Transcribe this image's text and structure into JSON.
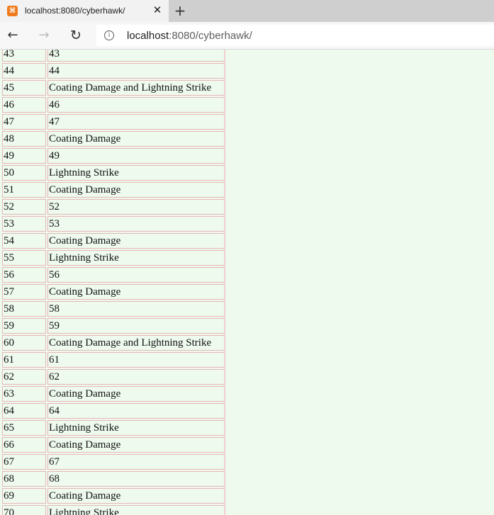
{
  "browser": {
    "tab_title": "localhost:8080/cyberhawk/",
    "url_host": "localhost",
    "url_rest": ":8080/cyberhawk/",
    "favicon_glyph": "⌘",
    "icons": {
      "back": "←",
      "forward": "→",
      "refresh": "↻",
      "close": "✕",
      "new_tab": "+",
      "info": "i"
    }
  },
  "table": {
    "rows": [
      {
        "id": "43",
        "value": "43"
      },
      {
        "id": "44",
        "value": "44"
      },
      {
        "id": "45",
        "value": "Coating Damage and Lightning Strike"
      },
      {
        "id": "46",
        "value": "46"
      },
      {
        "id": "47",
        "value": "47"
      },
      {
        "id": "48",
        "value": "Coating Damage"
      },
      {
        "id": "49",
        "value": "49"
      },
      {
        "id": "50",
        "value": "Lightning Strike"
      },
      {
        "id": "51",
        "value": "Coating Damage"
      },
      {
        "id": "52",
        "value": "52"
      },
      {
        "id": "53",
        "value": "53"
      },
      {
        "id": "54",
        "value": "Coating Damage"
      },
      {
        "id": "55",
        "value": "Lightning Strike"
      },
      {
        "id": "56",
        "value": "56"
      },
      {
        "id": "57",
        "value": "Coating Damage"
      },
      {
        "id": "58",
        "value": "58"
      },
      {
        "id": "59",
        "value": "59"
      },
      {
        "id": "60",
        "value": "Coating Damage and Lightning Strike"
      },
      {
        "id": "61",
        "value": "61"
      },
      {
        "id": "62",
        "value": "62"
      },
      {
        "id": "63",
        "value": "Coating Damage"
      },
      {
        "id": "64",
        "value": "64"
      },
      {
        "id": "65",
        "value": "Lightning Strike"
      },
      {
        "id": "66",
        "value": "Coating Damage"
      },
      {
        "id": "67",
        "value": "67"
      },
      {
        "id": "68",
        "value": "68"
      },
      {
        "id": "69",
        "value": "Coating Damage"
      },
      {
        "id": "70",
        "value": "Lightning Strike"
      }
    ]
  }
}
